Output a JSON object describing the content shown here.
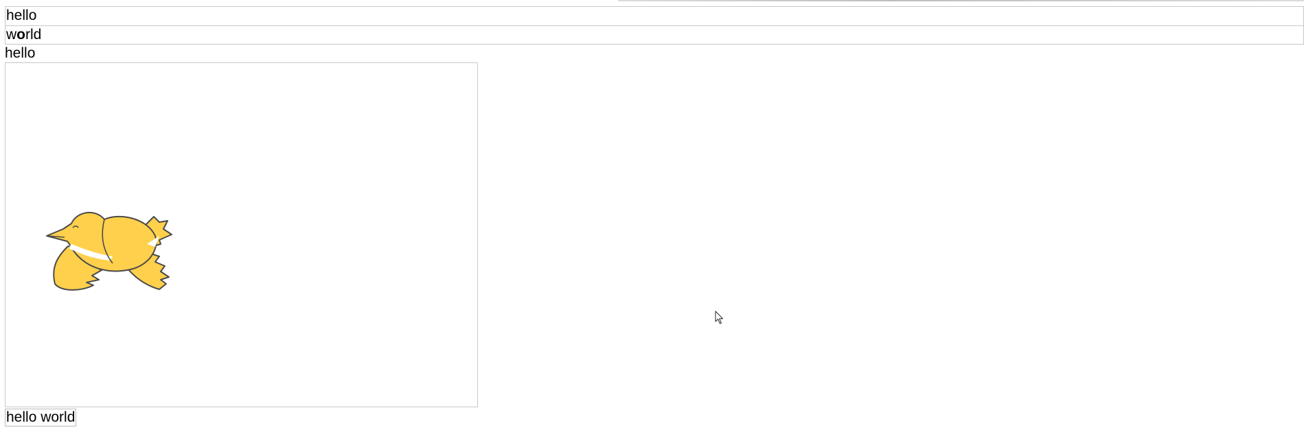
{
  "fields": {
    "first_value": "hello",
    "second_value_prefix": "w",
    "second_value_bold": "o",
    "second_value_suffix": "rld"
  },
  "plain_text": "hello",
  "button": {
    "label": "hello world"
  },
  "colors": {
    "bird_body": "#FFD04B",
    "bird_outline": "#4A4A4A",
    "bird_white": "#FFFFFF",
    "border": "#C8C8C8"
  },
  "icons": {
    "bird": "bird-illustration",
    "cursor": "arrow-cursor-icon"
  }
}
